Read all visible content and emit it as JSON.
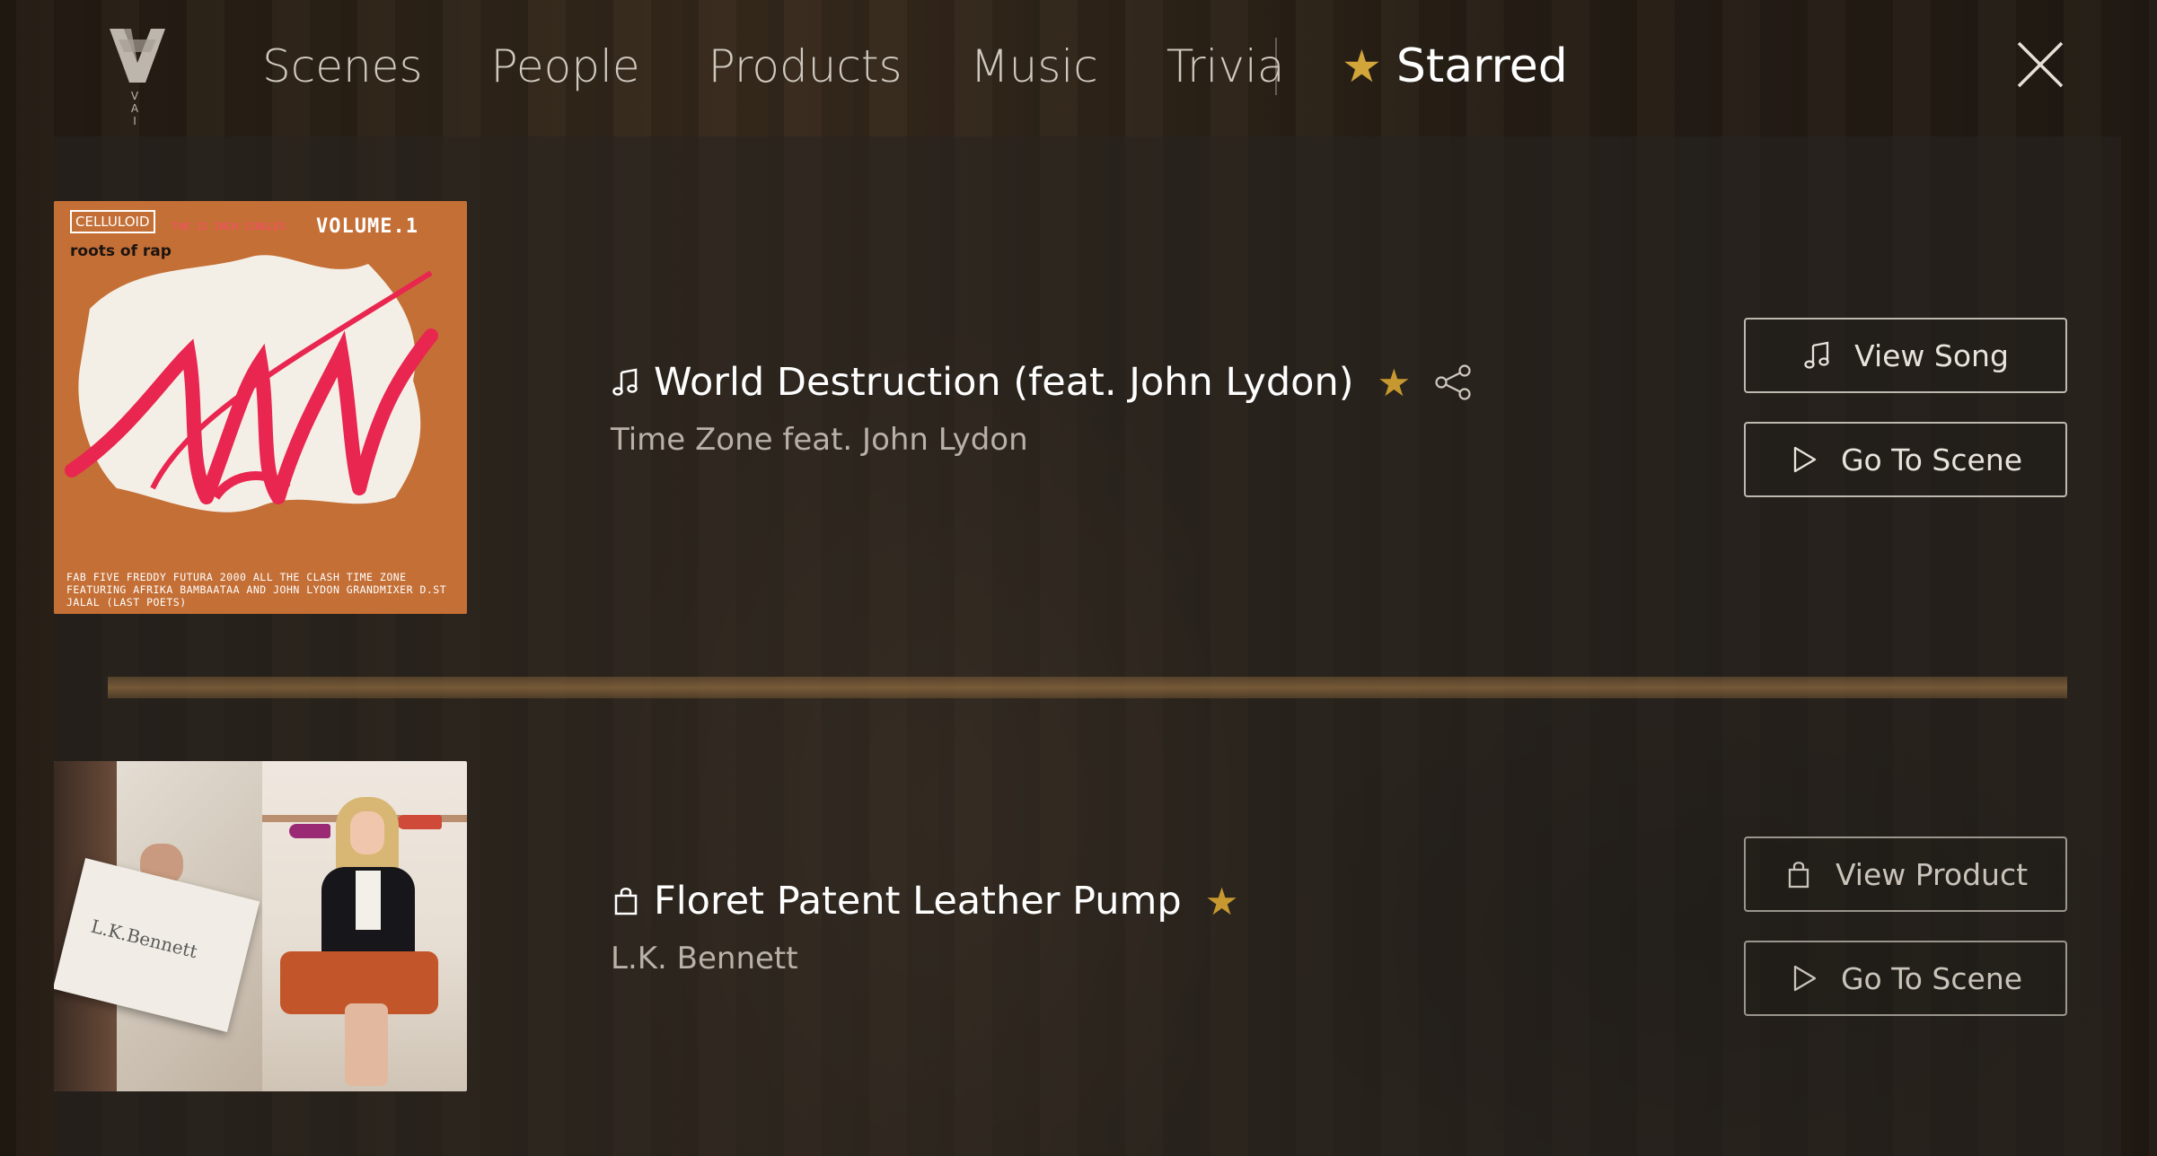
{
  "app": {
    "logo_letters": "V A I"
  },
  "nav": {
    "items": [
      {
        "label": "Scenes"
      },
      {
        "label": "People"
      },
      {
        "label": "Products"
      },
      {
        "label": "Music"
      },
      {
        "label": "Trivia"
      }
    ],
    "starred_label": "Starred",
    "starred_icon": "star-icon",
    "close_icon": "close-icon"
  },
  "starred": {
    "items": [
      {
        "type": "song",
        "icon": "music-note-icon",
        "title": "World Destruction (feat. John Lydon)",
        "subtitle": "Time Zone feat. John Lydon",
        "starred": true,
        "thumb": {
          "badge": "CELLULOID",
          "volume": "VOLUME.1",
          "small_text": "THE 12 INCH SINGLES",
          "roots": "roots of rap",
          "credits": "FAB FIVE FREDDY FUTURA 2000 ALL THE CLASH TIME ZONE FEATURING AFRIKA BAMBAATAA AND JOHN LYDON GRANDMIXER D.ST JALAL (LAST POETS)"
        },
        "primary_button": {
          "label": "View Song",
          "icon": "music-note-icon"
        },
        "secondary_button": {
          "label": "Go To Scene",
          "icon": "play-icon"
        }
      },
      {
        "type": "product",
        "icon": "shopping-bag-icon",
        "title": "Floret Patent Leather Pump",
        "subtitle": "L.K. Bennett",
        "starred": true,
        "thumb": {
          "box_text": "L.K.Bennett"
        },
        "primary_button": {
          "label": "View Product",
          "icon": "shopping-bag-icon"
        },
        "secondary_button": {
          "label": "Go To Scene",
          "icon": "play-icon"
        }
      }
    ]
  },
  "colors": {
    "star": "#c7982f",
    "text_primary": "#ffffff",
    "text_secondary": "#b8b1a7",
    "accent_separator": "#96703f"
  }
}
